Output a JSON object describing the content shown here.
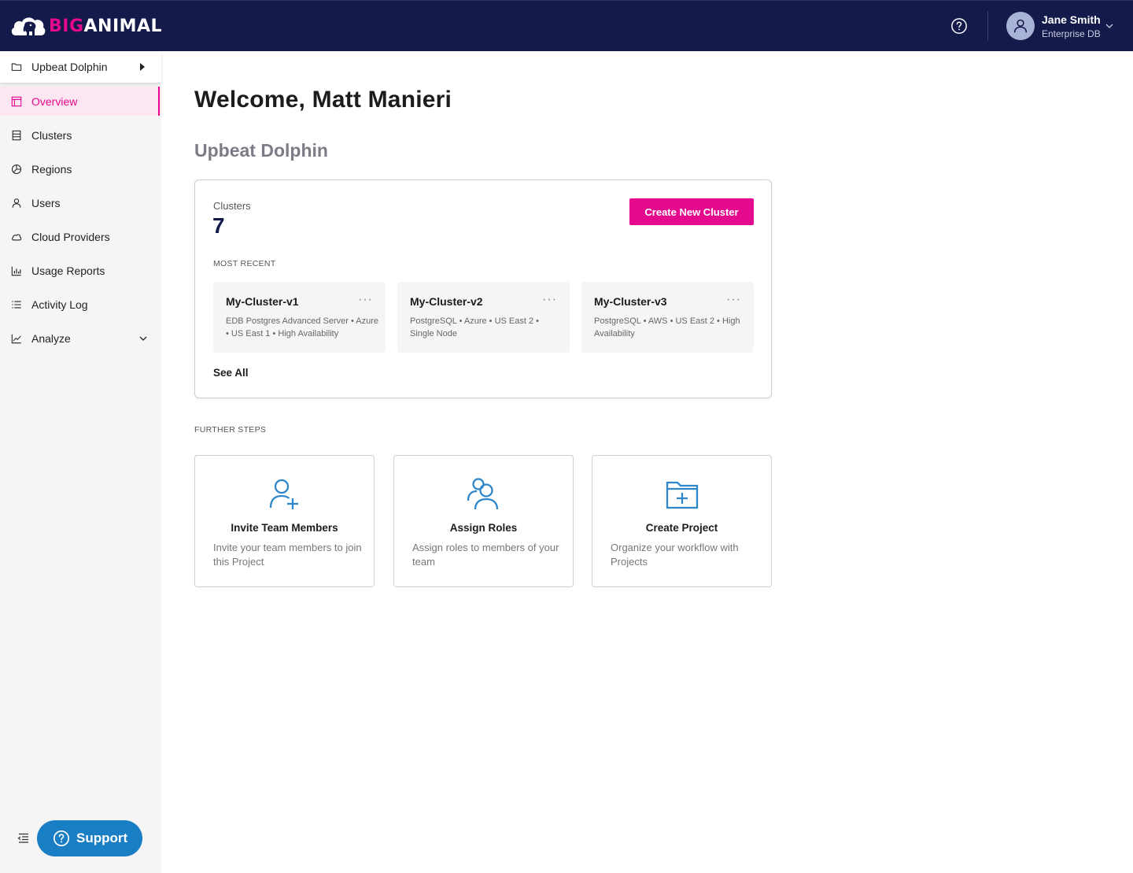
{
  "brand": {
    "name_part1": "BIG",
    "name_part2": "ANIMAL",
    "accent": "#e5098d",
    "header_bg": "#141a4a"
  },
  "header": {
    "help_icon": "help-circle-icon",
    "user": {
      "name": "Jane Smith",
      "org": "Enterprise DB"
    }
  },
  "sidebar": {
    "project": "Upbeat Dolphin",
    "items": [
      {
        "label": "Overview",
        "icon": "overview-icon",
        "active": true
      },
      {
        "label": "Clusters",
        "icon": "clusters-icon"
      },
      {
        "label": "Regions",
        "icon": "regions-icon"
      },
      {
        "label": "Users",
        "icon": "user-icon"
      },
      {
        "label": "Cloud Providers",
        "icon": "cloud-icon"
      },
      {
        "label": "Usage Reports",
        "icon": "bar-chart-icon"
      },
      {
        "label": "Activity Log",
        "icon": "list-icon"
      },
      {
        "label": "Analyze",
        "icon": "line-chart-icon",
        "expandable": true
      }
    ],
    "support_label": "Support"
  },
  "main": {
    "welcome": "Welcome, Matt Manieri",
    "project_title": "Upbeat Dolphin",
    "clusters_card": {
      "label": "Clusters",
      "count": "7",
      "create_button": "Create New Cluster",
      "most_recent_label": "MOST RECENT",
      "items": [
        {
          "name": "My-Cluster-v1",
          "desc": "EDB Postgres Advanced Server • Azure • US East 1 • High Availability"
        },
        {
          "name": "My-Cluster-v2",
          "desc": "PostgreSQL • Azure • US East 2 • Single Node"
        },
        {
          "name": "My-Cluster-v3",
          "desc": "PostgreSQL • AWS • US East 2 • High Availability"
        }
      ],
      "more_icon": "···",
      "see_all": "See All"
    },
    "further_steps_label": "FURTHER STEPS",
    "steps": [
      {
        "title": "Invite Team Members",
        "desc": "Invite your team members to join this Project",
        "icon": "user-plus-icon"
      },
      {
        "title": "Assign Roles",
        "desc": "Assign roles to members of your team",
        "icon": "users-icon"
      },
      {
        "title": "Create Project",
        "desc": "Organize your workflow with Projects",
        "icon": "folder-plus-icon"
      }
    ]
  }
}
